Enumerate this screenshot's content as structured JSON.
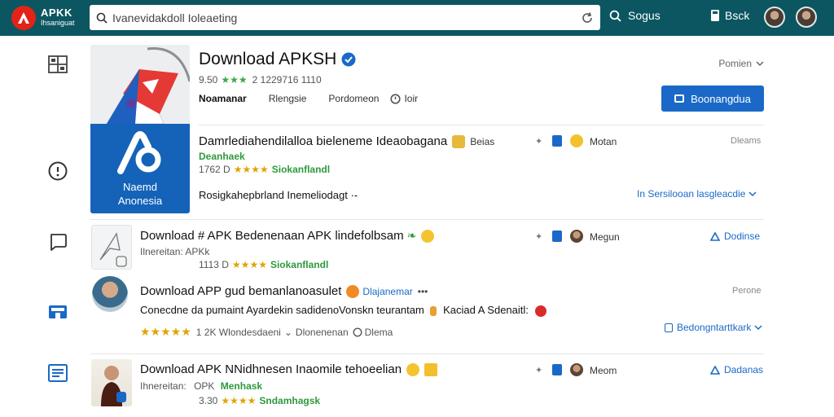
{
  "topbar": {
    "logo_line1": "APKK",
    "logo_line2": "Ihsaniguat",
    "search_value": "Ivanevidakdoll Ioleaeting",
    "search_label": "Sogus",
    "book_label": "Bsck"
  },
  "hero": {
    "caption_line1": "Naemd",
    "caption_line2": "Anonesia",
    "title": "Download APKSH",
    "rating": "9.50",
    "stars": "★★★",
    "downloads": "2 1229716 1110",
    "tabs": [
      "Noamanar",
      "Rlengsie",
      "Pordomeon",
      "Ioir"
    ],
    "dropdown": "Pomien",
    "install_label": "Boonangdua"
  },
  "rows": [
    {
      "title": "Damrlediahendilalloa bieleneme Ideaobagana",
      "side_label": "Beias",
      "side_label2": "Motan",
      "right_label": "Dleams",
      "sub": "Deanhaek",
      "rating": "1762 D",
      "stars": "★★★★",
      "tag": "Siokanflandl",
      "desc": "Rosigkahepbrland Inemeliodagt ·-",
      "link": "In Sersilooan lasgleacdie"
    },
    {
      "title": "Download # APK Bedenenaan APK lindefolbsam",
      "side_label": "Megun",
      "right_label": "Dodinse",
      "sub": "Ilnereitan: APKk",
      "rating": "1113 D",
      "stars": "★★★★",
      "tag": "Siokanflandl"
    },
    {
      "title": "Download APP gud bemanlanoasulet",
      "title_link": "Dlajanemar",
      "right_label": "Perone",
      "desc": "Conecdne da pumaint Ayardekin sadidenoVonskn teurantam",
      "desc_tail": "Kaciad A Sdenaitl:",
      "stars": "★★★★★",
      "count": "1 2K Wlondesdaeni",
      "meta2": "Dlonenenan",
      "meta3": "Dlema",
      "link": "Bedongntarttkark"
    },
    {
      "title": "Download APK NNidhnesen Inaomile tehoeelian",
      "side_label": "Meom",
      "right_label": "Dadanas",
      "sub": "Ihnereitan:",
      "sub2": "OPK",
      "tag2": "Menhask",
      "rating": "3.30",
      "stars": "★★★★",
      "tag": "Sndamhagsk"
    }
  ],
  "colors": {
    "topbar": "#0b5660",
    "accent": "#1a69c8",
    "green": "#2e9a3c",
    "logo_red": "#e2231a"
  }
}
